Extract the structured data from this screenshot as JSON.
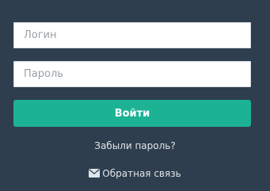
{
  "login_form": {
    "login_placeholder": "Логин",
    "password_placeholder": "Пароль",
    "submit_label": "Войти",
    "forgot_password_label": "Забыли пароль?",
    "feedback_label": "Обратная связь",
    "feedback_icon": "envelope-icon"
  },
  "colors": {
    "background": "#2f3e4e",
    "accent": "#1bb394",
    "link_text": "#dfe5ea"
  }
}
